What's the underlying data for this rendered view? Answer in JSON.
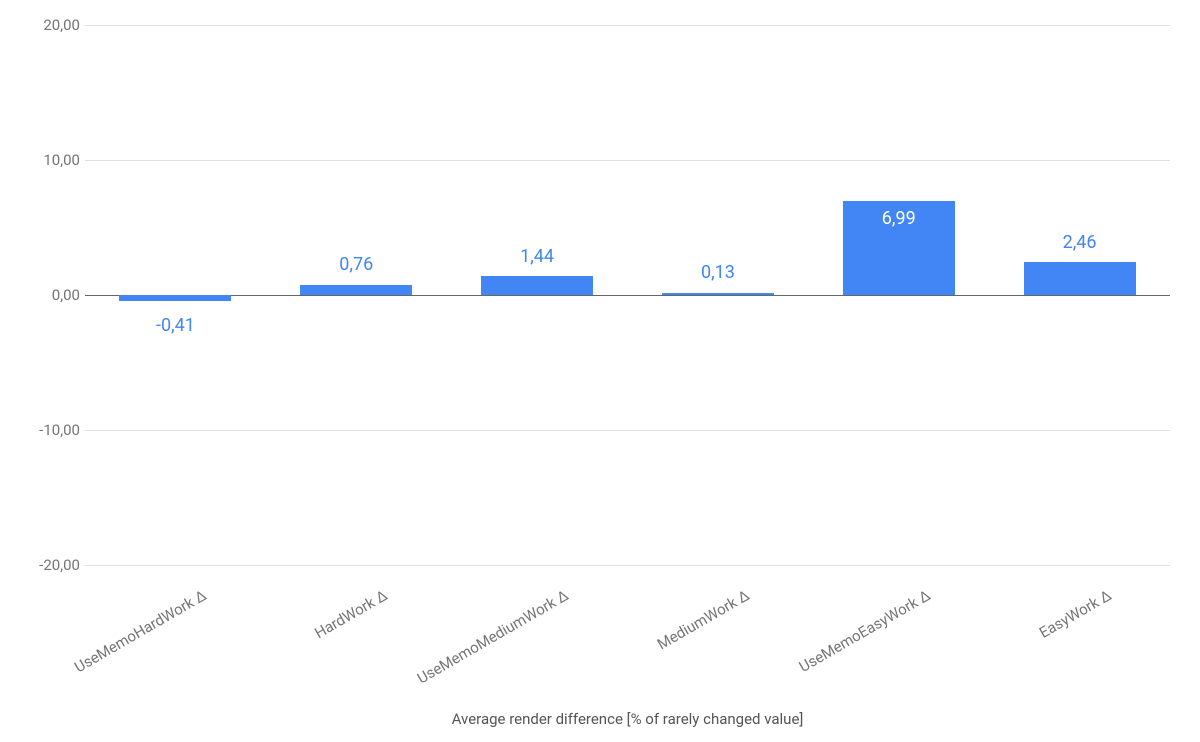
{
  "chart_data": {
    "type": "bar",
    "categories": [
      "UseMemoHardWork Δ",
      "HardWork Δ",
      "UseMemoMediumWork Δ",
      "MediumWork Δ",
      "UseMemoEasyWork Δ",
      "EasyWork Δ"
    ],
    "values": [
      -0.41,
      0.76,
      1.44,
      0.13,
      6.99,
      2.46
    ],
    "value_labels": [
      "-0,41",
      "0,76",
      "1,44",
      "0,13",
      "6,99",
      "2,46"
    ],
    "xlabel": "Average render difference [% of rarely changed value]",
    "ylabel": "",
    "ylim": [
      -20,
      20
    ],
    "yticks": [
      -20,
      -10,
      0,
      10,
      20
    ],
    "ytick_labels": [
      "-20,00",
      "-10,00",
      "0,00",
      "10,00",
      "20,00"
    ],
    "bar_color": "#4285f4",
    "label_inside_index": 4
  }
}
